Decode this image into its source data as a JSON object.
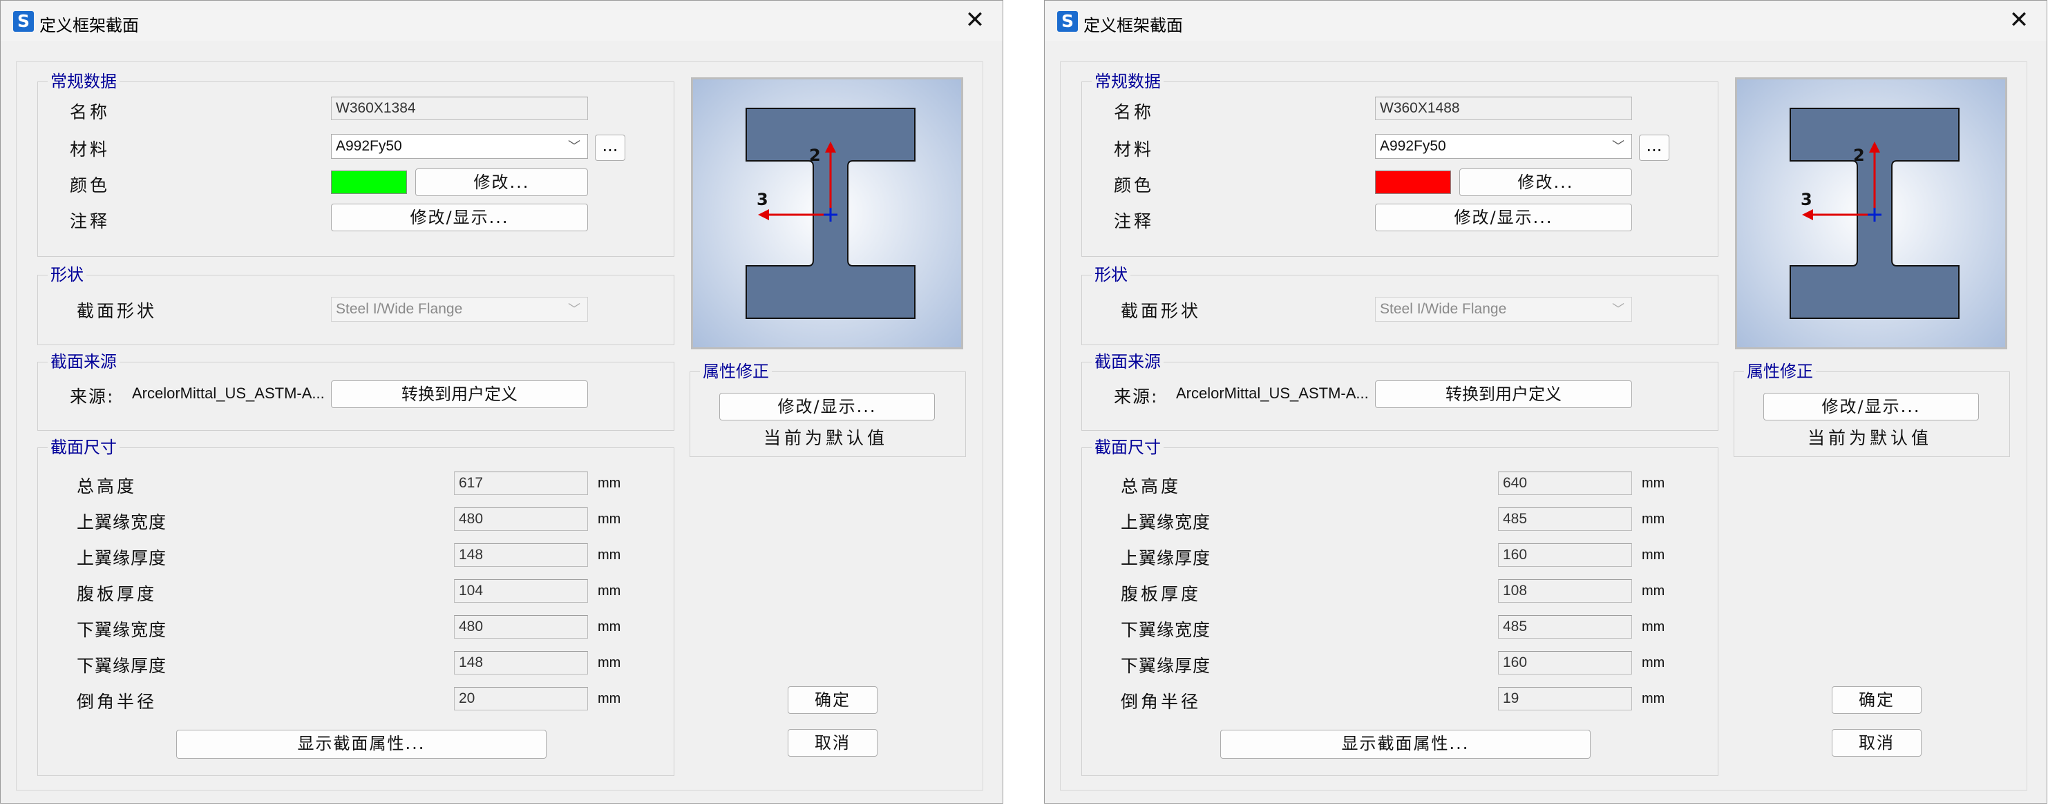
{
  "dialogs": [
    {
      "title": "定义框架截面",
      "app_icon": "S",
      "close_icon": "close-icon",
      "general": {
        "group_title": "常规数据",
        "name_label": "名称",
        "name_value": "W360X1384",
        "material_label": "材料",
        "material_value": "A992Fy50",
        "more_label": "...",
        "color_label": "颜色",
        "color_value": "#00ff00",
        "color_modify": "修改...",
        "notes_label": "注释",
        "notes_button": "修改/显示..."
      },
      "shape": {
        "group_title": "形状",
        "shape_label": "截面形状",
        "shape_value": "Steel I/Wide Flange"
      },
      "source": {
        "group_title": "截面来源",
        "source_label": "来源:",
        "source_value": "ArcelorMittal_US_ASTM-A...",
        "convert_button": "转换到用户定义"
      },
      "dimensions": {
        "group_title": "截面尺寸",
        "unit": "mm",
        "rows": [
          {
            "label": "总高度",
            "value": "617"
          },
          {
            "label": "上翼缘宽度",
            "value": "480"
          },
          {
            "label": "上翼缘厚度",
            "value": "148"
          },
          {
            "label": "腹板厚度",
            "value": "104"
          },
          {
            "label": "下翼缘宽度",
            "value": "480"
          },
          {
            "label": "下翼缘厚度",
            "value": "148"
          },
          {
            "label": "倒角半径",
            "value": "20"
          }
        ]
      },
      "show_props_button": "显示截面属性...",
      "modifiers": {
        "group_title": "属性修正",
        "modify_button": "修改/显示...",
        "status": "当前为默认值"
      },
      "preview": {
        "axis2": "2",
        "axis3": "3",
        "shape_color": "#5d7598"
      },
      "ok_button": "确定",
      "cancel_button": "取消"
    },
    {
      "title": "定义框架截面",
      "app_icon": "S",
      "close_icon": "close-icon",
      "general": {
        "group_title": "常规数据",
        "name_label": "名称",
        "name_value": "W360X1488",
        "material_label": "材料",
        "material_value": "A992Fy50",
        "more_label": "...",
        "color_label": "颜色",
        "color_value": "#ff0000",
        "color_modify": "修改...",
        "notes_label": "注释",
        "notes_button": "修改/显示..."
      },
      "shape": {
        "group_title": "形状",
        "shape_label": "截面形状",
        "shape_value": "Steel I/Wide Flange"
      },
      "source": {
        "group_title": "截面来源",
        "source_label": "来源:",
        "source_value": "ArcelorMittal_US_ASTM-A...",
        "convert_button": "转换到用户定义"
      },
      "dimensions": {
        "group_title": "截面尺寸",
        "unit": "mm",
        "rows": [
          {
            "label": "总高度",
            "value": "640"
          },
          {
            "label": "上翼缘宽度",
            "value": "485"
          },
          {
            "label": "上翼缘厚度",
            "value": "160"
          },
          {
            "label": "腹板厚度",
            "value": "108"
          },
          {
            "label": "下翼缘宽度",
            "value": "485"
          },
          {
            "label": "下翼缘厚度",
            "value": "160"
          },
          {
            "label": "倒角半径",
            "value": "19"
          }
        ]
      },
      "show_props_button": "显示截面属性...",
      "modifiers": {
        "group_title": "属性修正",
        "modify_button": "修改/显示...",
        "status": "当前为默认值"
      },
      "preview": {
        "axis2": "2",
        "axis3": "3",
        "shape_color": "#5d7598"
      },
      "ok_button": "确定",
      "cancel_button": "取消"
    }
  ]
}
